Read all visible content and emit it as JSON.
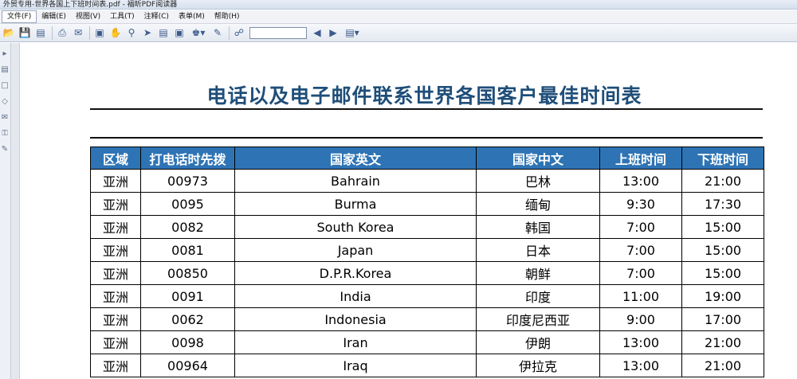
{
  "window": {
    "title": "外贸专用-世界各国上下班时间表.pdf - 福昕PDF阅读器"
  },
  "menu": [
    {
      "label": "文件(F)"
    },
    {
      "label": "编辑(E)"
    },
    {
      "label": "视图(V)"
    },
    {
      "label": "工具(T)"
    },
    {
      "label": "注释(C)"
    },
    {
      "label": "表单(M)"
    },
    {
      "label": "帮助(H)"
    }
  ],
  "toolbar": {
    "search_value": "",
    "icons": [
      "open-icon",
      "save-icon",
      "save-all-icon",
      "print-icon",
      "email-icon",
      "fullscreen-icon",
      "hand-icon",
      "zoom-icon",
      "select-icon",
      "text-select-icon",
      "snapshot-icon",
      "stamp-icon",
      "sign-icon",
      "find-icon",
      "find-prev-icon",
      "find-next-icon",
      "note-icon"
    ]
  },
  "document": {
    "title": "电话以及电子邮件联系世界各国客户最佳时间表",
    "columns": [
      "区域",
      "打电话时先拨",
      "国家英文",
      "国家中文",
      "上班时间",
      "下班时间"
    ],
    "rows": [
      [
        "亚洲",
        "00973",
        "Bahrain",
        "巴林",
        "13:00",
        "21:00"
      ],
      [
        "亚洲",
        "0095",
        "Burma",
        "缅甸",
        "9:30",
        "17:30"
      ],
      [
        "亚洲",
        "0082",
        "South Korea",
        "韩国",
        "7:00",
        "15:00"
      ],
      [
        "亚洲",
        "0081",
        "Japan",
        "日本",
        "7:00",
        "15:00"
      ],
      [
        "亚洲",
        "00850",
        "D.P.R.Korea",
        "朝鲜",
        "7:00",
        "15:00"
      ],
      [
        "亚洲",
        "0091",
        "India",
        "印度",
        "11:00",
        "19:00"
      ],
      [
        "亚洲",
        "0062",
        "Indonesia",
        "印度尼西亚",
        "9:00",
        "17:00"
      ],
      [
        "亚洲",
        "0098",
        "Iran",
        "伊朗",
        "13:00",
        "21:00"
      ],
      [
        "亚洲",
        "00964",
        "Iraq",
        "伊拉克",
        "13:00",
        "21:00"
      ]
    ]
  }
}
